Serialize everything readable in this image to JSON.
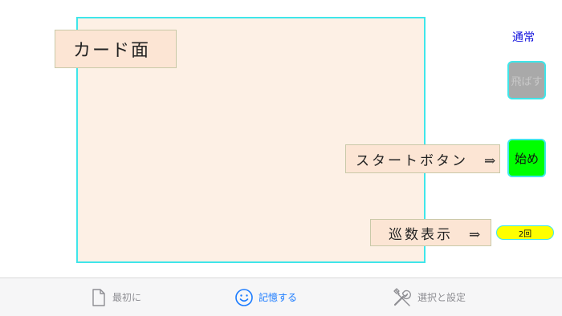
{
  "card": {
    "face_label": "カード面"
  },
  "controls": {
    "mode_label": "通常",
    "skip_button": "飛ばす",
    "begin_button": "始め",
    "start_button_hint": "スタートボタン　⇒",
    "count_hint": "巡数表示　⇒",
    "count_value": "2回"
  },
  "tabbar": {
    "tabs": [
      {
        "label": "最初に",
        "icon": "document-icon",
        "selected": false
      },
      {
        "label": "記憶する",
        "icon": "smiley-icon",
        "selected": true
      },
      {
        "label": "選択と設定",
        "icon": "tools-icon",
        "selected": false
      }
    ]
  },
  "colors": {
    "card_border": "#3fe6ea",
    "card_fill": "#fdf0e5",
    "begin_button": "#00ff00",
    "skip_button": "#a9a9a9",
    "count_badge": "#ffff00",
    "tab_active": "#1a7bff",
    "tab_inactive": "#8e8e93",
    "mode_label": "#1111dd"
  }
}
